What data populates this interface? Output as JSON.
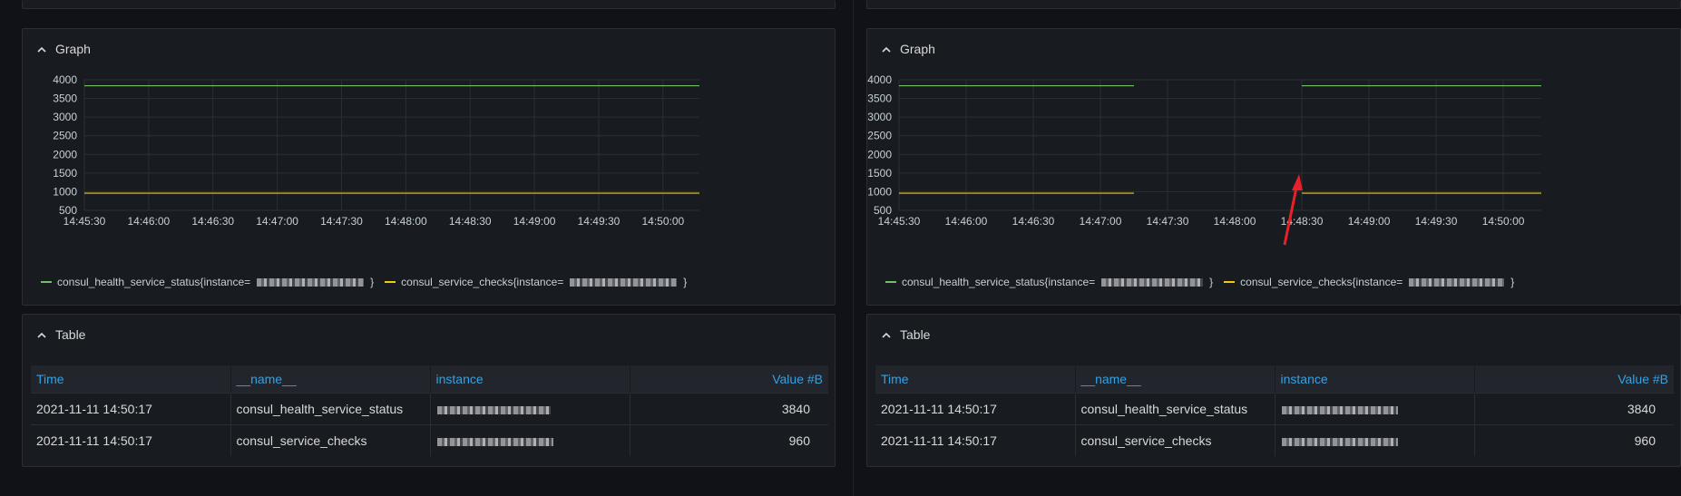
{
  "panels": {
    "graph_title": "Graph",
    "table_title": "Table"
  },
  "graph": {
    "legend": [
      {
        "name_prefix": "consul_health_service_status{instance=",
        "name_suffix": "}",
        "color": "#73bf69"
      },
      {
        "name_prefix": "consul_service_checks{instance=",
        "name_suffix": "}",
        "color": "#f2cc0c"
      }
    ]
  },
  "chart_data": [
    {
      "type": "line",
      "panel": "left",
      "title": "Graph",
      "xlabel": "",
      "ylabel": "",
      "ylim": [
        500,
        4000
      ],
      "yticks": [
        500,
        1000,
        1500,
        2000,
        2500,
        3000,
        3500,
        4000
      ],
      "xticks": [
        "14:45:30",
        "14:46:00",
        "14:46:30",
        "14:47:00",
        "14:47:30",
        "14:48:00",
        "14:48:30",
        "14:49:00",
        "14:49:30",
        "14:50:00"
      ],
      "xrange": [
        "14:45:30",
        "14:50:17"
      ],
      "grid": true,
      "series": [
        {
          "name": "consul_health_service_status",
          "color": "#73bf69",
          "segments": [
            {
              "x": [
                "14:45:30",
                "14:50:17"
              ],
              "value": 3840
            }
          ]
        },
        {
          "name": "consul_service_checks",
          "color": "#f2cc0c",
          "segments": [
            {
              "x": [
                "14:45:30",
                "14:50:17"
              ],
              "value": 960
            }
          ]
        }
      ]
    },
    {
      "type": "line",
      "panel": "right",
      "title": "Graph",
      "xlabel": "",
      "ylabel": "",
      "ylim": [
        500,
        4000
      ],
      "yticks": [
        500,
        1000,
        1500,
        2000,
        2500,
        3000,
        3500,
        4000
      ],
      "xticks": [
        "14:45:30",
        "14:46:00",
        "14:46:30",
        "14:47:00",
        "14:47:30",
        "14:48:00",
        "14:48:30",
        "14:49:00",
        "14:49:30",
        "14:50:00"
      ],
      "xrange": [
        "14:45:30",
        "14:50:17"
      ],
      "grid": true,
      "series": [
        {
          "name": "consul_health_service_status",
          "color": "#73bf69",
          "segments": [
            {
              "x": [
                "14:45:30",
                "14:47:15"
              ],
              "value": 3840
            },
            {
              "x": [
                "14:48:30",
                "14:50:17"
              ],
              "value": 3840
            }
          ]
        },
        {
          "name": "consul_service_checks",
          "color": "#f2cc0c",
          "segments": [
            {
              "x": [
                "14:45:30",
                "14:47:15"
              ],
              "value": 960
            },
            {
              "x": [
                "14:48:30",
                "14:50:17"
              ],
              "value": 960
            }
          ]
        }
      ]
    }
  ],
  "table": {
    "headers": [
      "Time",
      "__name__",
      "instance",
      "Value #B"
    ],
    "rows": [
      {
        "time": "2021-11-11 14:50:17",
        "name": "consul_health_service_status",
        "value": "3840"
      },
      {
        "time": "2021-11-11 14:50:17",
        "name": "consul_service_checks",
        "value": "960"
      }
    ]
  },
  "annotation": {
    "arrow_color": "#e8202a"
  }
}
